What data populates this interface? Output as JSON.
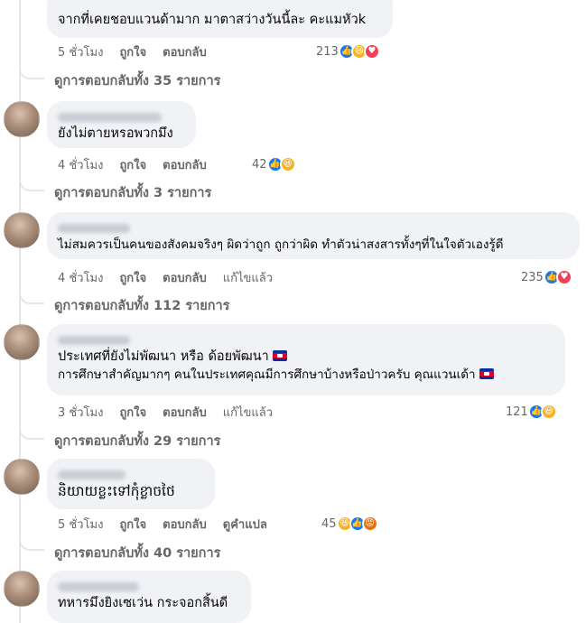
{
  "comments": [
    {
      "text_lines": [
        "จากที่เคยชอบแวนด้ามาก มาตาสว่างวันนี้ละ คะแมหัวk"
      ],
      "time": "5 ชั่วโมง",
      "like": "ถูกใจ",
      "reply": "ตอบกลับ",
      "extra": "",
      "reaction_count": "213",
      "reactions": [
        "like-icon",
        "haha-icon",
        "love-icon"
      ],
      "view_replies": "ดูการตอบกลับทั้ง 35 รายการ"
    },
    {
      "text_lines": [
        "ยังไม่ตายหรอพวกมึง"
      ],
      "time": "4 ชั่วโมง",
      "like": "ถูกใจ",
      "reply": "ตอบกลับ",
      "extra": "",
      "reaction_count": "42",
      "reactions": [
        "like-icon",
        "haha-icon"
      ],
      "view_replies": "ดูการตอบกลับทั้ง 3 รายการ"
    },
    {
      "text_lines": [
        "ไม่สมควรเป็นคนของสังคมจริงๆ ผิดว่าถูก ถูกว่าผิด ทำตัวน่าสงสารทั้งๆที่ในใจตัวเองรู้ดี"
      ],
      "time": "4 ชั่วโมง",
      "like": "ถูกใจ",
      "reply": "ตอบกลับ",
      "extra": "แก้ไขแล้ว",
      "reaction_count": "235",
      "reactions": [
        "like-icon",
        "love-icon"
      ],
      "view_replies": "ดูการตอบกลับทั้ง 112 รายการ"
    },
    {
      "text_lines": [
        "ประเทศที่ยังไม่พัฒนา หรือ ด้อยพัฒนา",
        "การศึกษาสำคัญมากๆ คนในประเทศคุณมีการศึกษาบ้างหรือป่าวครับ คุณแวนเด้า"
      ],
      "time": "3 ชั่วโมง",
      "like": "ถูกใจ",
      "reply": "ตอบกลับ",
      "extra": "แก้ไขแล้ว",
      "reaction_count": "121",
      "reactions": [
        "like-icon",
        "haha-icon"
      ],
      "view_replies": "ดูการตอบกลับทั้ง 29 รายการ"
    },
    {
      "text_lines": [
        "និយាយខ្លះទៅកុំខ្លាចថៃ"
      ],
      "time": "5 ชั่วโมง",
      "like": "ถูกใจ",
      "reply": "ตอบกลับ",
      "extra": "ดูคำแปล",
      "reaction_count": "45",
      "reactions": [
        "haha-icon",
        "like-icon",
        "angry-icon"
      ],
      "view_replies": "ดูการตอบกลับทั้ง 40 รายการ"
    },
    {
      "text_lines": [
        "ทหารมึงยิงเซเว่น กระจอกสิ้นดี"
      ]
    }
  ]
}
